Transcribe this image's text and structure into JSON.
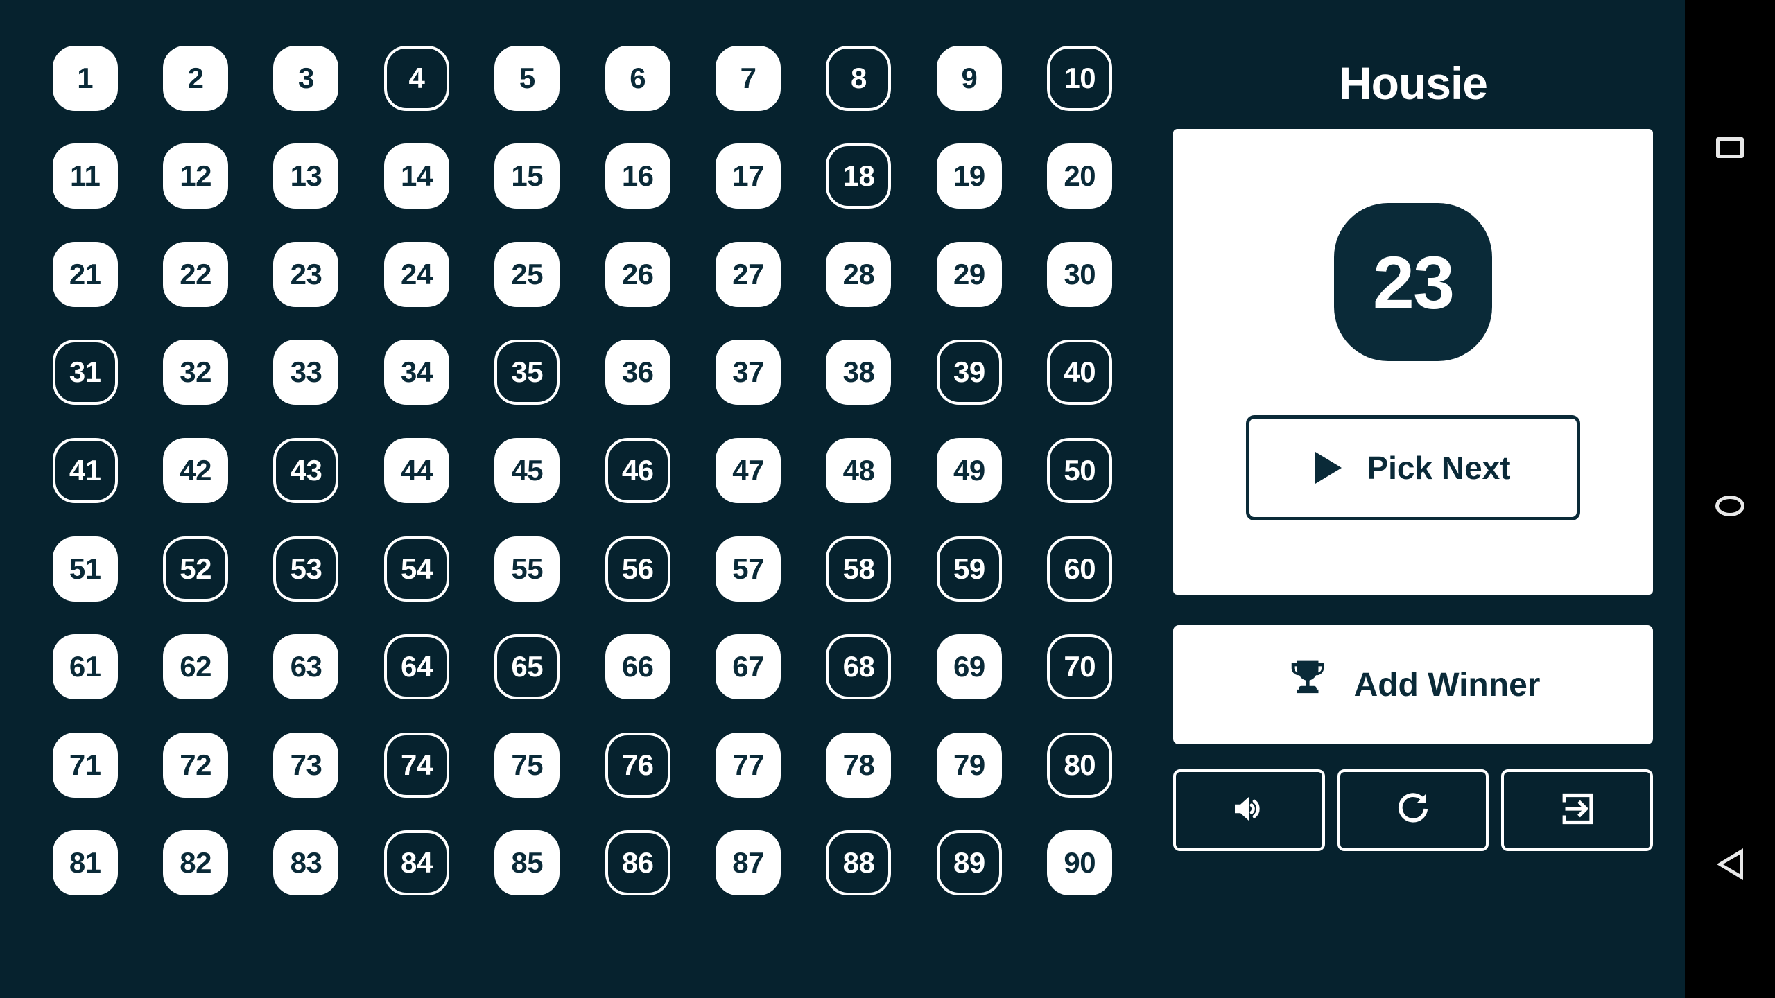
{
  "app": {
    "title": "Housie",
    "background_color": "#06222e",
    "accent_color": "#0a2a38",
    "surface_color": "#ffffff"
  },
  "board": {
    "total_numbers": 90,
    "columns": 10,
    "rows": 9,
    "numbers": [
      1,
      2,
      3,
      4,
      5,
      6,
      7,
      8,
      9,
      10,
      11,
      12,
      13,
      14,
      15,
      16,
      17,
      18,
      19,
      20,
      21,
      22,
      23,
      24,
      25,
      26,
      27,
      28,
      29,
      30,
      31,
      32,
      33,
      34,
      35,
      36,
      37,
      38,
      39,
      40,
      41,
      42,
      43,
      44,
      45,
      46,
      47,
      48,
      49,
      50,
      51,
      52,
      53,
      54,
      55,
      56,
      57,
      58,
      59,
      60,
      61,
      62,
      63,
      64,
      65,
      66,
      67,
      68,
      69,
      70,
      71,
      72,
      73,
      74,
      75,
      76,
      77,
      78,
      79,
      80,
      81,
      82,
      83,
      84,
      85,
      86,
      87,
      88,
      89,
      90
    ],
    "called_numbers": [
      4,
      8,
      10,
      18,
      31,
      35,
      39,
      40,
      41,
      43,
      46,
      50,
      52,
      53,
      54,
      56,
      58,
      59,
      60,
      64,
      65,
      68,
      70,
      74,
      76,
      80,
      84,
      86,
      88,
      89
    ]
  },
  "current_number_card": {
    "current_number": "23",
    "pick_next_label": "Pick Next",
    "play_icon": "play-triangle-icon"
  },
  "add_winner": {
    "label": "Add Winner",
    "icon": "trophy-icon"
  },
  "actions": [
    {
      "name": "sound-toggle",
      "icon": "volume-icon"
    },
    {
      "name": "restart-game",
      "icon": "refresh-icon"
    },
    {
      "name": "exit-game",
      "icon": "exit-icon"
    }
  ],
  "nav_bar": {
    "buttons": [
      {
        "name": "recents",
        "icon": "square-icon"
      },
      {
        "name": "home",
        "icon": "circle-icon"
      },
      {
        "name": "back",
        "icon": "triangle-icon"
      }
    ]
  }
}
